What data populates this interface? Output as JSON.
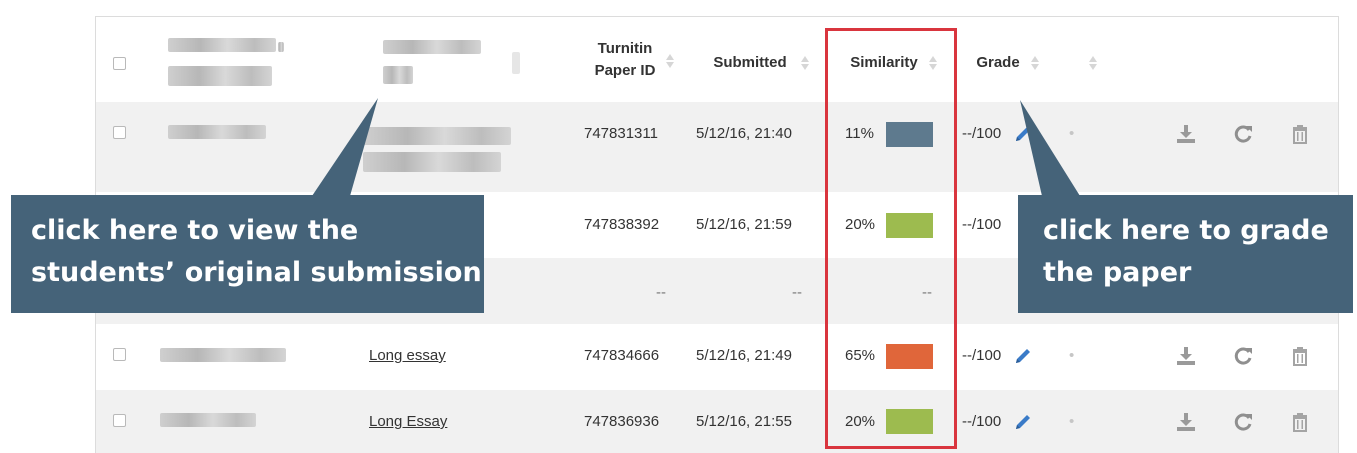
{
  "table": {
    "headers": {
      "paper_id": "Turnitin Paper ID",
      "submitted": "Submitted",
      "similarity": "Similarity",
      "grade": "Grade"
    },
    "rows": [
      {
        "title": "",
        "paper_id": "747831311",
        "submitted": "5/12/16, 21:40",
        "similarity": "11%",
        "similarity_color": "#5e7a8e",
        "grade": "--/100"
      },
      {
        "title": "",
        "paper_id": "747838392",
        "submitted": "5/12/16, 21:59",
        "similarity": "20%",
        "similarity_color": "#9dbb4f",
        "grade": "--/100"
      },
      {
        "title": "",
        "paper_id": "--",
        "submitted": "--",
        "similarity": "--",
        "similarity_color": "",
        "grade": ""
      },
      {
        "title": "Long essay",
        "paper_id": "747834666",
        "submitted": "5/12/16, 21:49",
        "similarity": "65%",
        "similarity_color": "#e0663a",
        "grade": "--/100"
      },
      {
        "title": "Long Essay",
        "paper_id": "747836936",
        "submitted": "5/12/16, 21:55",
        "similarity": "20%",
        "similarity_color": "#9dbb4f",
        "grade": "--/100"
      }
    ],
    "dot": "•"
  },
  "callouts": {
    "left": [
      "click here to view the",
      "students’ original submission"
    ],
    "right": [
      "click here to grade",
      "the paper"
    ]
  },
  "icons": {
    "download": "download-icon",
    "refresh": "refresh-icon",
    "trash": "trash-icon",
    "pencil": "pencil-icon"
  },
  "colors": {
    "highlight_border": "#d9353e",
    "callout_bg": "#456379"
  }
}
